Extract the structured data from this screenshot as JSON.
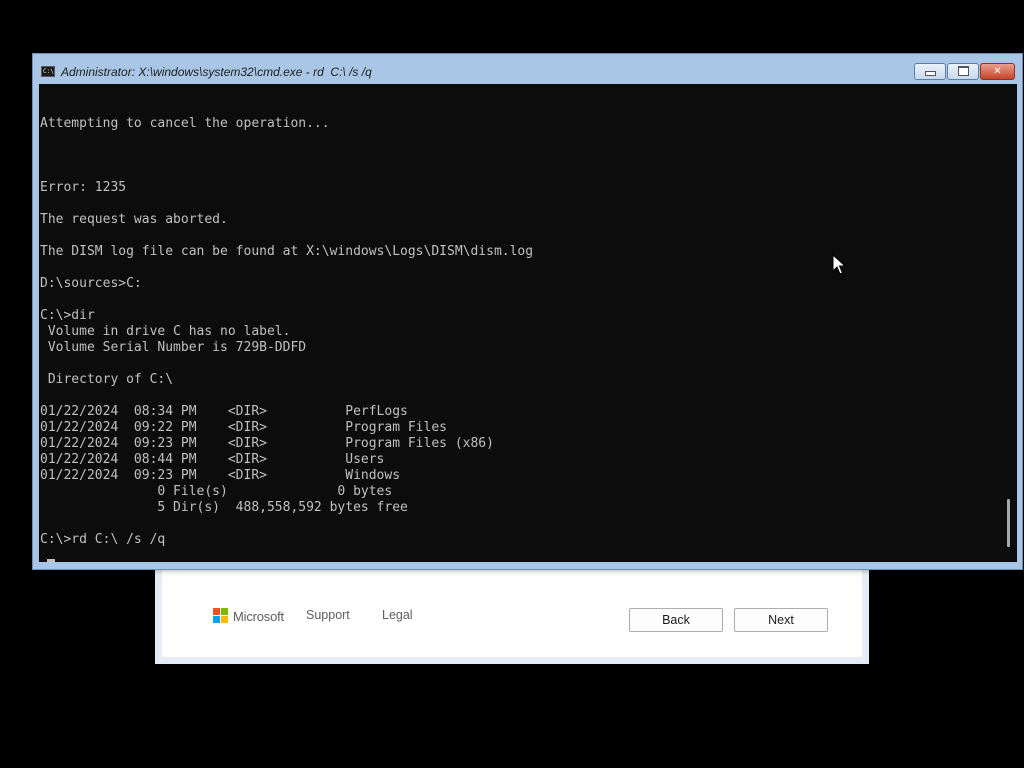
{
  "setup": {
    "brand": "Microsoft",
    "links": [
      "Support",
      "Legal"
    ],
    "back_label": "Back",
    "next_label": "Next",
    "logo_colors": [
      "#f25022",
      "#7fba00",
      "#00a4ef",
      "#ffb900"
    ]
  },
  "console_window": {
    "title": "Administrator: X:\\windows\\system32\\cmd.exe - rd  C:\\ /s /q",
    "icon_label": "C:\\",
    "minimize_label": "minimize",
    "maximize_label": "maximize",
    "close_label": "✕",
    "lines": [
      "",
      "",
      "Attempting to cancel the operation...",
      "",
      "",
      "",
      "Error: 1235",
      "",
      "The request was aborted.",
      "",
      "The DISM log file can be found at X:\\windows\\Logs\\DISM\\dism.log",
      "",
      "D:\\sources>C:",
      "",
      "C:\\>dir",
      " Volume in drive C has no label.",
      " Volume Serial Number is 729B-DDFD",
      "",
      " Directory of C:\\",
      "",
      "01/22/2024  08:34 PM    <DIR>          PerfLogs",
      "01/22/2024  09:22 PM    <DIR>          Program Files",
      "01/22/2024  09:23 PM    <DIR>          Program Files (x86)",
      "01/22/2024  08:44 PM    <DIR>          Users",
      "01/22/2024  09:23 PM    <DIR>          Windows",
      "               0 File(s)              0 bytes",
      "               5 Dir(s)  488,558,592 bytes free",
      "",
      "C:\\>rd C:\\ /s /q"
    ]
  },
  "colors": {
    "console_bg": "#0c0c0c",
    "console_fg": "#c0c0c0",
    "window_frame": "#a9c6e6"
  }
}
